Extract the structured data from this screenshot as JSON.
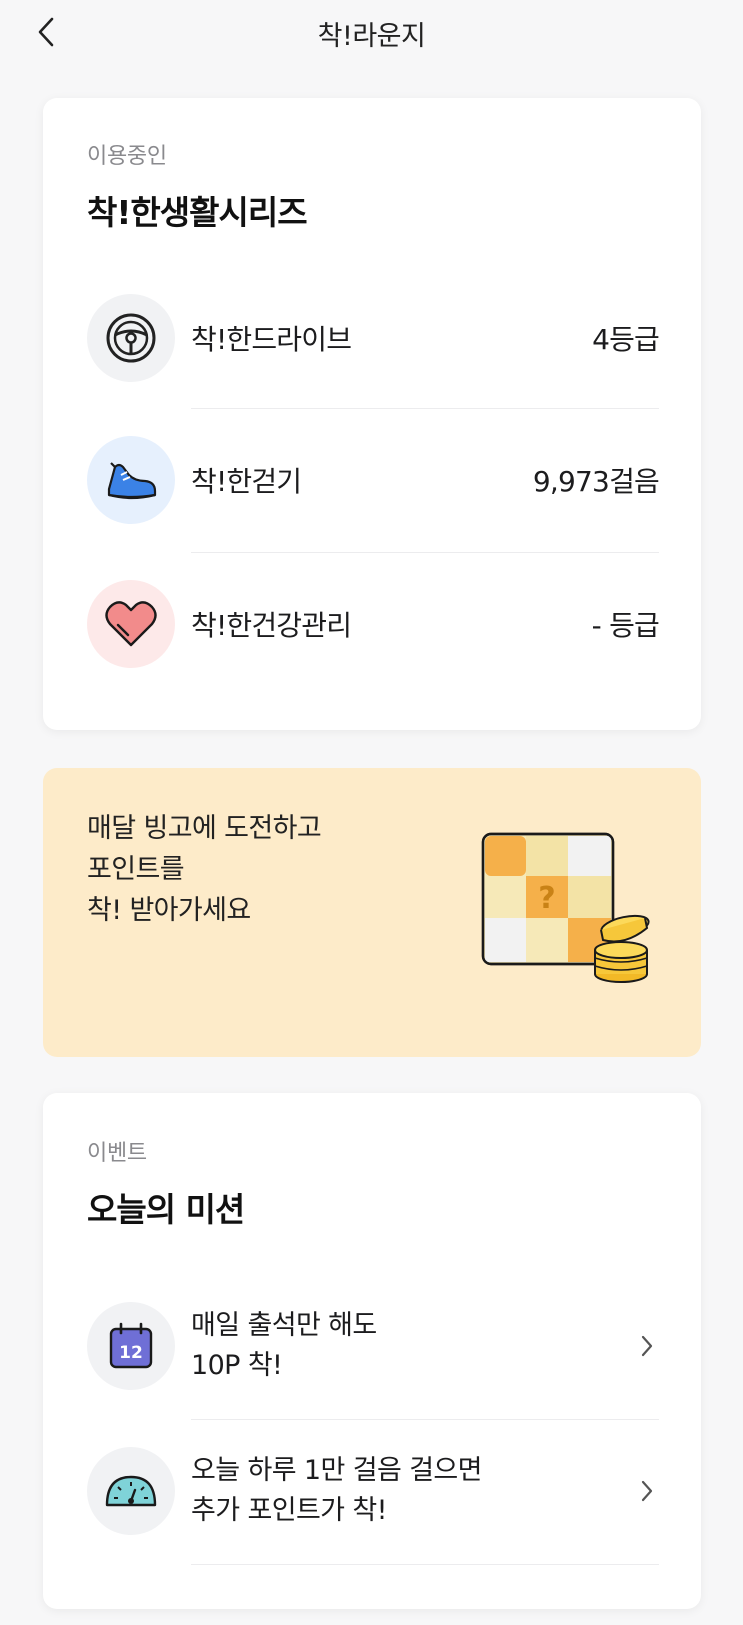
{
  "header": {
    "title": "착!라운지",
    "back_icon": "chevron-left-icon"
  },
  "series_card": {
    "overline": "이용중인",
    "heading": "착!한생활시리즈",
    "items": [
      {
        "label": "착!한드라이브",
        "value": "4등급",
        "icon": "steering-wheel-icon",
        "icon_bg": "#f1f2f4"
      },
      {
        "label": "착!한걷기",
        "value": "9,973걸음",
        "icon": "sneaker-icon",
        "icon_bg": "#e6f0fd"
      },
      {
        "label": "착!한건강관리",
        "value": "- 등급",
        "icon": "heart-icon",
        "icon_bg": "#fde9e9"
      }
    ]
  },
  "bingo_banner": {
    "lines": [
      "매달 빙고에 도전하고",
      "포인트를",
      "착! 받아가세요"
    ],
    "art_icon": "bingo-board-coins-icon",
    "bg_color": "#fdebc9",
    "board_mark": "?"
  },
  "mission_card": {
    "overline": "이벤트",
    "heading": "오늘의 미션",
    "items": [
      {
        "lines": [
          "매일 출석만 해도",
          "10P 착!"
        ],
        "icon": "calendar-icon",
        "calendar_day": "12"
      },
      {
        "lines": [
          "오늘 하루 1만 걸음 걸으면",
          "추가 포인트가 착!"
        ],
        "icon": "speedometer-icon"
      }
    ]
  }
}
